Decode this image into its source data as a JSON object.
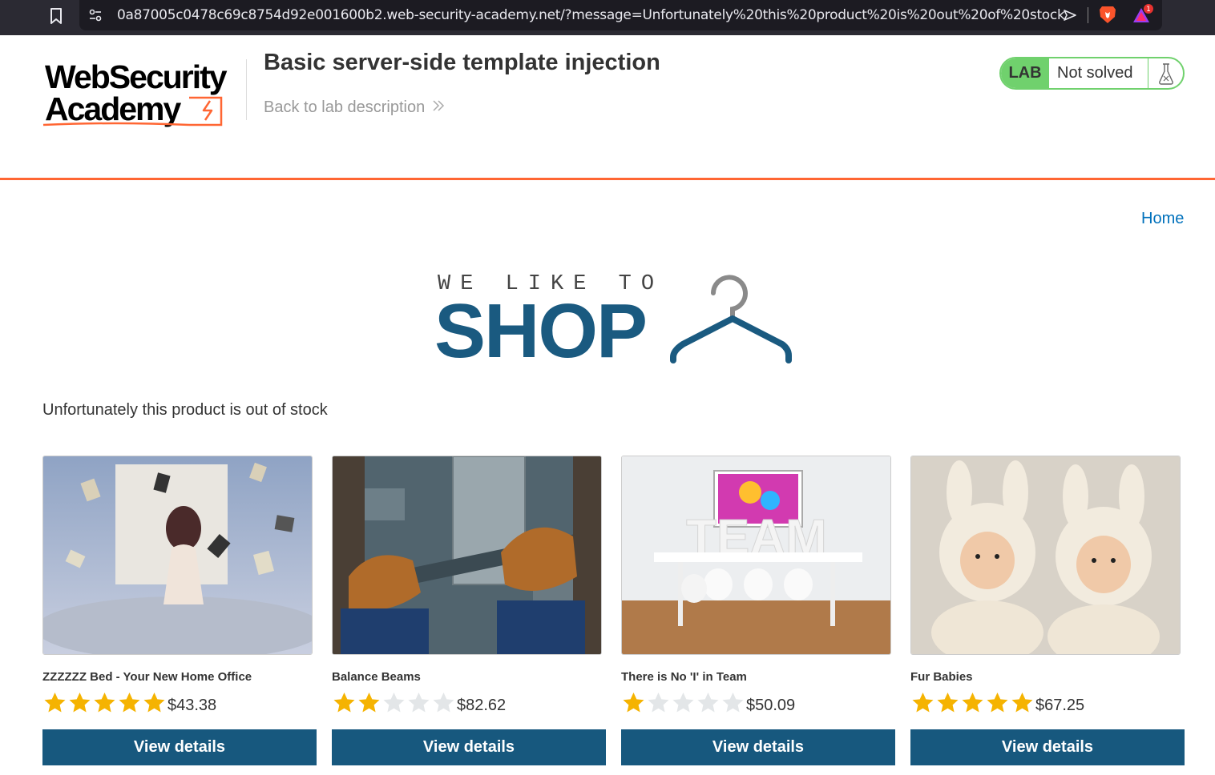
{
  "browser": {
    "url": "0a87005c0478c69c8754d92e001600b2.web-security-academy.net/?message=Unfortunately%20this%20product%20is%20out%20of%20stock",
    "notification_count": "1"
  },
  "academy": {
    "logo_line1": "WebSecurity",
    "logo_line2": "Academy",
    "lab_title": "Basic server-side template injection",
    "back_link": "Back to lab description",
    "lab_badge": "LAB",
    "lab_status": "Not solved"
  },
  "nav": {
    "home": "Home"
  },
  "banner": {
    "small": "WE LIKE TO",
    "big": "SHOP"
  },
  "message": "Unfortunately this product is out of stock",
  "products": [
    {
      "name": "ZZZZZZ Bed - Your New Home Office",
      "rating": 5,
      "price": "$43.38",
      "button": "View details"
    },
    {
      "name": "Balance Beams",
      "rating": 2,
      "price": "$82.62",
      "button": "View details"
    },
    {
      "name": "There is No 'I' in Team",
      "rating": 1,
      "price": "$50.09",
      "button": "View details"
    },
    {
      "name": "Fur Babies",
      "rating": 5,
      "price": "$67.25",
      "button": "View details"
    }
  ],
  "colors": {
    "accent": "#ff6633",
    "lab_green": "#70d16d",
    "button_blue": "#17587e",
    "star_filled": "#f5b301",
    "star_empty": "#e3e6e8"
  }
}
